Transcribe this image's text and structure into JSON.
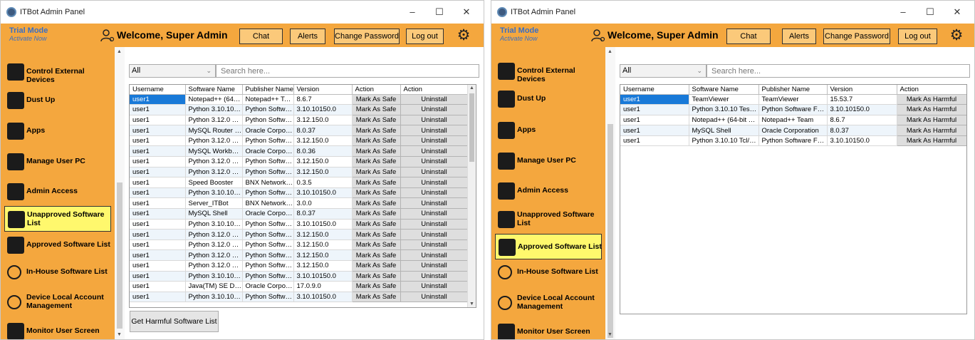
{
  "left": {
    "window_title": "ITBot Admin Panel",
    "header": {
      "trial": "Trial Mode",
      "trial_sub": "Activate Now",
      "welcome": "Welcome, Super Admin",
      "chat": "Chat",
      "alerts": "Alerts",
      "change_password": "Change Password",
      "logout": "Log out"
    },
    "sidebar": [
      {
        "label": "Control External Devices",
        "icon": "usb-device-icon"
      },
      {
        "label": "Dust Up",
        "icon": "laptop-check-icon"
      },
      {
        "label": "Apps",
        "icon": "apps-grid-icon"
      },
      {
        "label": "Manage User PC",
        "icon": "monitor-icon"
      },
      {
        "label": "Admin Access",
        "icon": "admin-users-icon"
      },
      {
        "label": "Unapproved Software List",
        "icon": "unapproved-software-icon"
      },
      {
        "label": "Approved Software List",
        "icon": "approved-software-icon"
      },
      {
        "label": "In-House Software List",
        "icon": "in-house-software-icon"
      },
      {
        "label": "Device Local Account Management",
        "icon": "user-gear-icon"
      },
      {
        "label": "Monitor User Screen",
        "icon": "monitor-screen-icon"
      }
    ],
    "active_item": 5,
    "filter": "All",
    "search_placeholder": "Search here...",
    "columns": [
      "Username",
      "Software Name",
      "Publisher Name",
      "Version",
      "Action",
      "Action"
    ],
    "rows": [
      [
        "user1",
        "Notepad++ (64-bit ...",
        "Notepad++ Team",
        "8.6.7",
        "Mark As Safe",
        "Uninstall"
      ],
      [
        "user1",
        "Python 3.10.10 Test ...",
        "Python Software Fo...",
        "3.10.10150.0",
        "Mark As Safe",
        "Uninstall"
      ],
      [
        "user1",
        "Python 3.12.0 Test S...",
        "Python Software Fo...",
        "3.12.150.0",
        "Mark As Safe",
        "Uninstall"
      ],
      [
        "user1",
        "MySQL Router 8.0",
        "Oracle Corporation",
        "8.0.37",
        "Mark As Safe",
        "Uninstall"
      ],
      [
        "user1",
        "Python 3.12.0 Stand...",
        "Python Software Fo...",
        "3.12.150.0",
        "Mark As Safe",
        "Uninstall"
      ],
      [
        "user1",
        "MySQL Workbench ...",
        "Oracle Corporation",
        "8.0.36",
        "Mark As Safe",
        "Uninstall"
      ],
      [
        "user1",
        "Python 3.12.0 Devel...",
        "Python Software Fo...",
        "3.12.150.0",
        "Mark As Safe",
        "Uninstall"
      ],
      [
        "user1",
        "Python 3.12.0 pip B...",
        "Python Software Fo...",
        "3.12.150.0",
        "Mark As Safe",
        "Uninstall"
      ],
      [
        "user1",
        "Speed Booster",
        "BNX Networks Inc",
        "0.3.5",
        "Mark As Safe",
        "Uninstall"
      ],
      [
        "user1",
        "Python 3.10.10 Tcl/T...",
        "Python Software Fo...",
        "3.10.10150.0",
        "Mark As Safe",
        "Uninstall"
      ],
      [
        "user1",
        "Server_ITBot",
        "BNX Networks Inc",
        "3.0.0",
        "Mark As Safe",
        "Uninstall"
      ],
      [
        "user1",
        "MySQL Shell",
        "Oracle Corporation",
        "8.0.37",
        "Mark As Safe",
        "Uninstall"
      ],
      [
        "user1",
        "Python 3.10.10 Stan...",
        "Python Software Fo...",
        "3.10.10150.0",
        "Mark As Safe",
        "Uninstall"
      ],
      [
        "user1",
        "Python 3.12.0 Execu...",
        "Python Software Fo...",
        "3.12.150.0",
        "Mark As Safe",
        "Uninstall"
      ],
      [
        "user1",
        "Python 3.12.0 Docu...",
        "Python Software Fo...",
        "3.12.150.0",
        "Mark As Safe",
        "Uninstall"
      ],
      [
        "user1",
        "Python 3.12.0 Core I...",
        "Python Software Fo...",
        "3.12.150.0",
        "Mark As Safe",
        "Uninstall"
      ],
      [
        "user1",
        "Python 3.12.0 Tcl/Tk...",
        "Python Software Fo...",
        "3.12.150.0",
        "Mark As Safe",
        "Uninstall"
      ],
      [
        "user1",
        "Python 3.10.10 Test ...",
        "Python Software Fo...",
        "3.10.10150.0",
        "Mark As Safe",
        "Uninstall"
      ],
      [
        "user1",
        "Java(TM) SE Develo...",
        "Oracle Corporation",
        "17.0.9.0",
        "Mark As Safe",
        "Uninstall"
      ],
      [
        "user1",
        "Python 3.10.10 Exec...",
        "Python Software Fo...",
        "3.10.10150.0",
        "Mark As Safe",
        "Uninstall"
      ]
    ],
    "get_harmful_button": "Get Harmful Software List"
  },
  "right": {
    "window_title": "ITBot Admin Panel",
    "header": {
      "trial": "Trial Mode",
      "trial_sub": "Activate Now",
      "welcome": "Welcome, Super Admin",
      "chat": "Chat",
      "alerts": "Alerts",
      "change_password": "Change Password",
      "logout": "Log out"
    },
    "sidebar": [
      {
        "label": "Control External Devices",
        "icon": "usb-device-icon"
      },
      {
        "label": "Dust Up",
        "icon": "laptop-check-icon"
      },
      {
        "label": "Apps",
        "icon": "apps-grid-icon"
      },
      {
        "label": "Manage User PC",
        "icon": "monitor-icon"
      },
      {
        "label": "Admin Access",
        "icon": "admin-users-icon"
      },
      {
        "label": "Unapproved Software List",
        "icon": "unapproved-software-icon"
      },
      {
        "label": "Approved Software List",
        "icon": "approved-software-icon"
      },
      {
        "label": "In-House Software List",
        "icon": "in-house-software-icon"
      },
      {
        "label": "Device Local Account Management",
        "icon": "user-gear-icon"
      },
      {
        "label": "Monitor User Screen",
        "icon": "monitor-screen-icon"
      }
    ],
    "active_item": 6,
    "filter": "All",
    "search_placeholder": "Search here...",
    "columns": [
      "Username",
      "Software Name",
      "Publisher Name",
      "Version",
      "Action"
    ],
    "rows": [
      [
        "user1",
        "TeamViewer",
        "TeamViewer",
        "15.53.7",
        "Mark As Harmful"
      ],
      [
        "user1",
        "Python 3.10.10 Test Suite ...",
        "Python Software Foundat...",
        "3.10.10150.0",
        "Mark As Harmful"
      ],
      [
        "user1",
        "Notepad++ (64-bit x64)",
        "Notepad++ Team",
        "8.6.7",
        "Mark As Harmful"
      ],
      [
        "user1",
        "MySQL Shell",
        "Oracle Corporation",
        "8.0.37",
        "Mark As Harmful"
      ],
      [
        "user1",
        "Python 3.10.10 Tcl/Tk Sup...",
        "Python Software Foundat...",
        "3.10.10150.0",
        "Mark As Harmful"
      ]
    ]
  },
  "colors": {
    "accent": "#f4a73e",
    "active": "#fff86d",
    "selection": "#1879d8",
    "trial": "#3a6fc4"
  }
}
